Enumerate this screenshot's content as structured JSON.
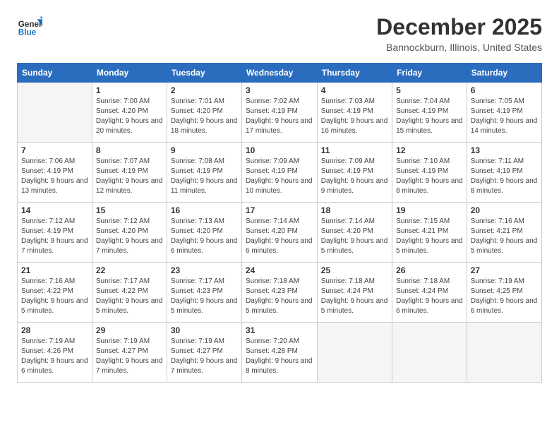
{
  "logo": {
    "general": "General",
    "blue": "Blue"
  },
  "header": {
    "month": "December 2025",
    "location": "Bannockburn, Illinois, United States"
  },
  "weekdays": [
    "Sunday",
    "Monday",
    "Tuesday",
    "Wednesday",
    "Thursday",
    "Friday",
    "Saturday"
  ],
  "weeks": [
    [
      {
        "day": null,
        "info": null
      },
      {
        "day": "1",
        "info": "Sunrise: 7:00 AM\nSunset: 4:20 PM\nDaylight: 9 hours\nand 20 minutes."
      },
      {
        "day": "2",
        "info": "Sunrise: 7:01 AM\nSunset: 4:20 PM\nDaylight: 9 hours\nand 18 minutes."
      },
      {
        "day": "3",
        "info": "Sunrise: 7:02 AM\nSunset: 4:19 PM\nDaylight: 9 hours\nand 17 minutes."
      },
      {
        "day": "4",
        "info": "Sunrise: 7:03 AM\nSunset: 4:19 PM\nDaylight: 9 hours\nand 16 minutes."
      },
      {
        "day": "5",
        "info": "Sunrise: 7:04 AM\nSunset: 4:19 PM\nDaylight: 9 hours\nand 15 minutes."
      },
      {
        "day": "6",
        "info": "Sunrise: 7:05 AM\nSunset: 4:19 PM\nDaylight: 9 hours\nand 14 minutes."
      }
    ],
    [
      {
        "day": "7",
        "info": "Sunrise: 7:06 AM\nSunset: 4:19 PM\nDaylight: 9 hours\nand 13 minutes."
      },
      {
        "day": "8",
        "info": "Sunrise: 7:07 AM\nSunset: 4:19 PM\nDaylight: 9 hours\nand 12 minutes."
      },
      {
        "day": "9",
        "info": "Sunrise: 7:08 AM\nSunset: 4:19 PM\nDaylight: 9 hours\nand 11 minutes."
      },
      {
        "day": "10",
        "info": "Sunrise: 7:09 AM\nSunset: 4:19 PM\nDaylight: 9 hours\nand 10 minutes."
      },
      {
        "day": "11",
        "info": "Sunrise: 7:09 AM\nSunset: 4:19 PM\nDaylight: 9 hours\nand 9 minutes."
      },
      {
        "day": "12",
        "info": "Sunrise: 7:10 AM\nSunset: 4:19 PM\nDaylight: 9 hours\nand 8 minutes."
      },
      {
        "day": "13",
        "info": "Sunrise: 7:11 AM\nSunset: 4:19 PM\nDaylight: 9 hours\nand 8 minutes."
      }
    ],
    [
      {
        "day": "14",
        "info": "Sunrise: 7:12 AM\nSunset: 4:19 PM\nDaylight: 9 hours\nand 7 minutes."
      },
      {
        "day": "15",
        "info": "Sunrise: 7:12 AM\nSunset: 4:20 PM\nDaylight: 9 hours\nand 7 minutes."
      },
      {
        "day": "16",
        "info": "Sunrise: 7:13 AM\nSunset: 4:20 PM\nDaylight: 9 hours\nand 6 minutes."
      },
      {
        "day": "17",
        "info": "Sunrise: 7:14 AM\nSunset: 4:20 PM\nDaylight: 9 hours\nand 6 minutes."
      },
      {
        "day": "18",
        "info": "Sunrise: 7:14 AM\nSunset: 4:20 PM\nDaylight: 9 hours\nand 5 minutes."
      },
      {
        "day": "19",
        "info": "Sunrise: 7:15 AM\nSunset: 4:21 PM\nDaylight: 9 hours\nand 5 minutes."
      },
      {
        "day": "20",
        "info": "Sunrise: 7:16 AM\nSunset: 4:21 PM\nDaylight: 9 hours\nand 5 minutes."
      }
    ],
    [
      {
        "day": "21",
        "info": "Sunrise: 7:16 AM\nSunset: 4:22 PM\nDaylight: 9 hours\nand 5 minutes."
      },
      {
        "day": "22",
        "info": "Sunrise: 7:17 AM\nSunset: 4:22 PM\nDaylight: 9 hours\nand 5 minutes."
      },
      {
        "day": "23",
        "info": "Sunrise: 7:17 AM\nSunset: 4:23 PM\nDaylight: 9 hours\nand 5 minutes."
      },
      {
        "day": "24",
        "info": "Sunrise: 7:18 AM\nSunset: 4:23 PM\nDaylight: 9 hours\nand 5 minutes."
      },
      {
        "day": "25",
        "info": "Sunrise: 7:18 AM\nSunset: 4:24 PM\nDaylight: 9 hours\nand 5 minutes."
      },
      {
        "day": "26",
        "info": "Sunrise: 7:18 AM\nSunset: 4:24 PM\nDaylight: 9 hours\nand 6 minutes."
      },
      {
        "day": "27",
        "info": "Sunrise: 7:19 AM\nSunset: 4:25 PM\nDaylight: 9 hours\nand 6 minutes."
      }
    ],
    [
      {
        "day": "28",
        "info": "Sunrise: 7:19 AM\nSunset: 4:26 PM\nDaylight: 9 hours\nand 6 minutes."
      },
      {
        "day": "29",
        "info": "Sunrise: 7:19 AM\nSunset: 4:27 PM\nDaylight: 9 hours\nand 7 minutes."
      },
      {
        "day": "30",
        "info": "Sunrise: 7:19 AM\nSunset: 4:27 PM\nDaylight: 9 hours\nand 7 minutes."
      },
      {
        "day": "31",
        "info": "Sunrise: 7:20 AM\nSunset: 4:28 PM\nDaylight: 9 hours\nand 8 minutes."
      },
      {
        "day": null,
        "info": null
      },
      {
        "day": null,
        "info": null
      },
      {
        "day": null,
        "info": null
      }
    ]
  ]
}
